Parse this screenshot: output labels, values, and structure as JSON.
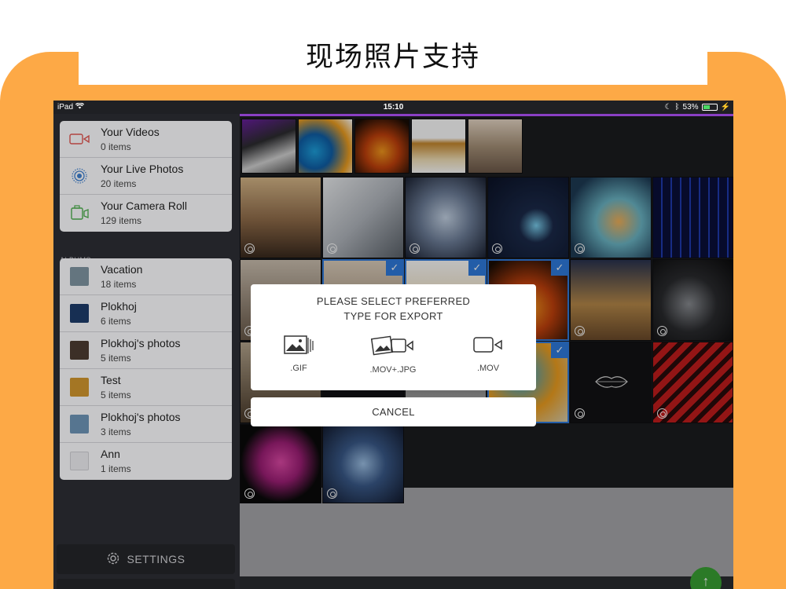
{
  "headline": "现场照片支持",
  "status_bar": {
    "device": "iPad",
    "time": "15:10",
    "battery": "53%",
    "battery_level": 0.53
  },
  "sidebar": {
    "library": [
      {
        "title": "Your Videos",
        "count": "0 items",
        "icon": "video-icon"
      },
      {
        "title": "Your Live Photos",
        "count": "20 items",
        "icon": "live-photo-icon"
      },
      {
        "title": "Your Camera Roll",
        "count": "129 items",
        "icon": "camera-icon"
      }
    ],
    "albums_label": "ALBUMS",
    "albums": [
      {
        "title": "Vacation",
        "count": "18 items",
        "color": "#7b8f9c"
      },
      {
        "title": "Plokhoj",
        "count": "6 items",
        "color": "#1d3a66"
      },
      {
        "title": "Plokhoj's photos",
        "count": "5 items",
        "color": "#4a3a30"
      },
      {
        "title": "Test",
        "count": "5 items",
        "color": "#c8902c"
      },
      {
        "title": "Plokhoj's photos",
        "count": "3 items",
        "color": "#6a8fb0"
      },
      {
        "title": "Ann",
        "count": "1 items",
        "color": "#e4e4e8"
      }
    ],
    "settings_label": "SETTINGS"
  },
  "dialog": {
    "title_line1": "PLEASE SELECT PREFERRED",
    "title_line2": "TYPE FOR EXPORT",
    "options": [
      {
        "label": ".GIF",
        "icon": "gif-icon"
      },
      {
        "label": ".MOV+.JPG",
        "icon": "mov-jpg-icon"
      },
      {
        "label": ".MOV",
        "icon": "mov-icon"
      }
    ],
    "cancel_label": "CANCEL"
  },
  "colors": {
    "frame": "#FDA946",
    "accent_blue": "#2f7de0",
    "purple": "#8a3fc4",
    "fab_green": "#3aa335"
  }
}
